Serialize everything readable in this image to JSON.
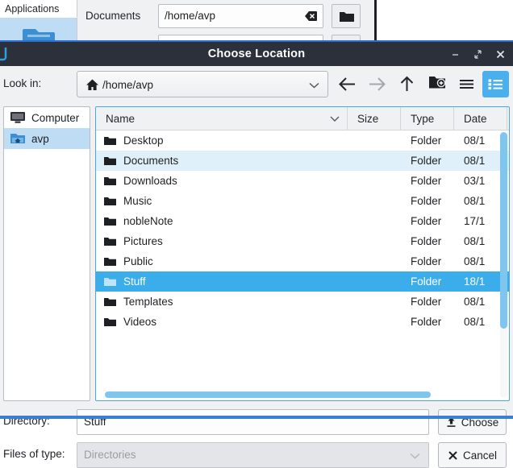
{
  "background_app": {
    "tab_label": "Applications",
    "folder_icon": "folder-icon",
    "field_label": "Documents",
    "field_value": "/home/avp",
    "clear_icon": "clear-text-icon",
    "browse_icon": "folder-icon"
  },
  "dialog": {
    "title": "Choose Location",
    "window_buttons": {
      "minimize": "minimize-icon",
      "restore": "restore-icon",
      "close": "close-icon"
    },
    "toolbar": {
      "lookin_label": "Look in:",
      "lookin_value": "/home/avp",
      "lookin_icon": "home-icon",
      "buttons": [
        {
          "name": "back-button",
          "icon": "arrow-left-icon",
          "enabled": true
        },
        {
          "name": "forward-button",
          "icon": "arrow-right-icon",
          "enabled": false
        },
        {
          "name": "parent-directory-button",
          "icon": "arrow-up-icon",
          "enabled": true
        },
        {
          "name": "new-folder-button",
          "icon": "new-folder-icon",
          "enabled": true
        },
        {
          "name": "list-view-button",
          "icon": "list-view-icon",
          "enabled": true
        },
        {
          "name": "detail-view-button",
          "icon": "detail-view-icon",
          "enabled": true,
          "active": true
        }
      ]
    },
    "sidebar": {
      "items": [
        {
          "label": "Computer",
          "icon": "computer-icon",
          "selected": false
        },
        {
          "label": "avp",
          "icon": "home-folder-icon",
          "selected": true
        }
      ]
    },
    "file_list": {
      "columns": [
        "Name",
        "Size",
        "Type",
        "Date"
      ],
      "sort_column": "Name",
      "sort_icon": "chevron-down-icon",
      "rows": [
        {
          "name": "Desktop",
          "size": "",
          "type": "Folder",
          "date": "08/1",
          "state": "normal"
        },
        {
          "name": "Documents",
          "size": "",
          "type": "Folder",
          "date": "08/1",
          "state": "highlight"
        },
        {
          "name": "Downloads",
          "size": "",
          "type": "Folder",
          "date": "03/1",
          "state": "normal"
        },
        {
          "name": "Music",
          "size": "",
          "type": "Folder",
          "date": "08/1",
          "state": "normal"
        },
        {
          "name": "nobleNote",
          "size": "",
          "type": "Folder",
          "date": "17/1",
          "state": "normal"
        },
        {
          "name": "Pictures",
          "size": "",
          "type": "Folder",
          "date": "08/1",
          "state": "normal"
        },
        {
          "name": "Public",
          "size": "",
          "type": "Folder",
          "date": "08/1",
          "state": "normal"
        },
        {
          "name": "Stuff",
          "size": "",
          "type": "Folder",
          "date": "18/1",
          "state": "selected"
        },
        {
          "name": "Templates",
          "size": "",
          "type": "Folder",
          "date": "08/1",
          "state": "normal"
        },
        {
          "name": "Videos",
          "size": "",
          "type": "Folder",
          "date": "08/1",
          "state": "normal"
        }
      ]
    },
    "form": {
      "directory_label": "Directory:",
      "directory_value": "Stuff",
      "filetype_label": "Files of type:",
      "filetype_value": "Directories",
      "choose_label": "Choose",
      "choose_icon": "upload-icon",
      "cancel_label": "Cancel",
      "cancel_icon": "close-x-icon"
    }
  },
  "colors": {
    "titlebar": "#2c303b",
    "accent": "#3cadeb",
    "selection": "#3cadeb",
    "highlight_row": "#dff0fb",
    "sidebar_selection": "#bfdcf5",
    "bottom_accent": "#3b7fd4",
    "panel": "#f0f1f3"
  }
}
